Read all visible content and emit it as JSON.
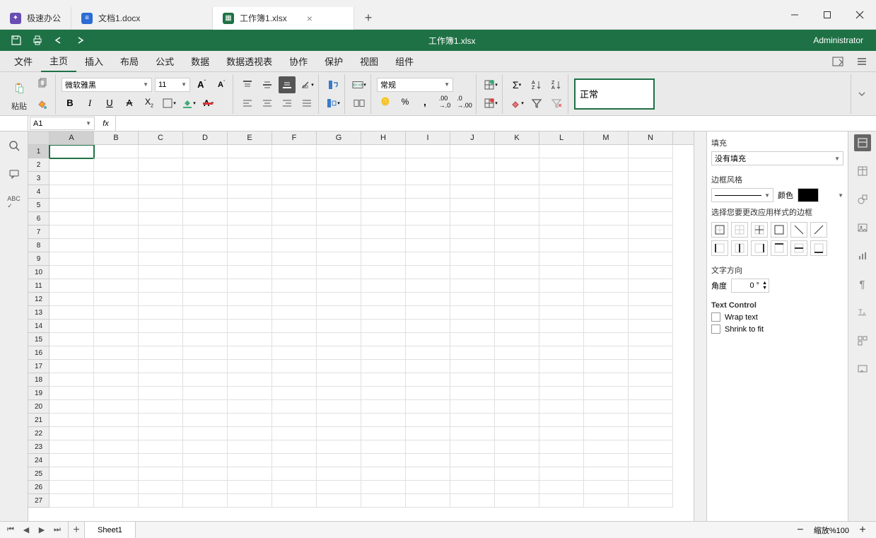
{
  "titlebar": {
    "app_tab": "极速办公",
    "doc_tab": "文档1.docx",
    "sheet_tab": "工作簿1.xlsx"
  },
  "qat": {
    "title": "工作簿1.xlsx",
    "user": "Administrator"
  },
  "menu": {
    "items": [
      "文件",
      "主页",
      "插入",
      "布局",
      "公式",
      "数据",
      "数据透视表",
      "协作",
      "保护",
      "视图",
      "组件"
    ],
    "active_index": 1
  },
  "ribbon": {
    "paste_label": "粘贴",
    "font_name": "微软雅黑",
    "font_size": "11",
    "number_format": "常规",
    "style_label": "正常"
  },
  "formula_bar": {
    "cell_ref": "A1",
    "fx": "fx",
    "value": ""
  },
  "grid": {
    "columns": [
      "A",
      "B",
      "C",
      "D",
      "E",
      "F",
      "G",
      "H",
      "I",
      "J",
      "K",
      "L",
      "M",
      "N"
    ],
    "row_count": 27,
    "active_cell": "A1"
  },
  "right_panel": {
    "fill_label": "填充",
    "fill_value": "没有填充",
    "border_style_label": "边框风格",
    "color_label": "颜色",
    "border_hint": "选择您要更改应用样式的边框",
    "text_dir_label": "文字方向",
    "angle_label": "角度",
    "angle_value": "0 °",
    "text_control_label": "Text Control",
    "wrap_label": "Wrap text",
    "shrink_label": "Shrink to fit"
  },
  "status": {
    "sheet_name": "Sheet1",
    "zoom_label": "缩放%100"
  }
}
